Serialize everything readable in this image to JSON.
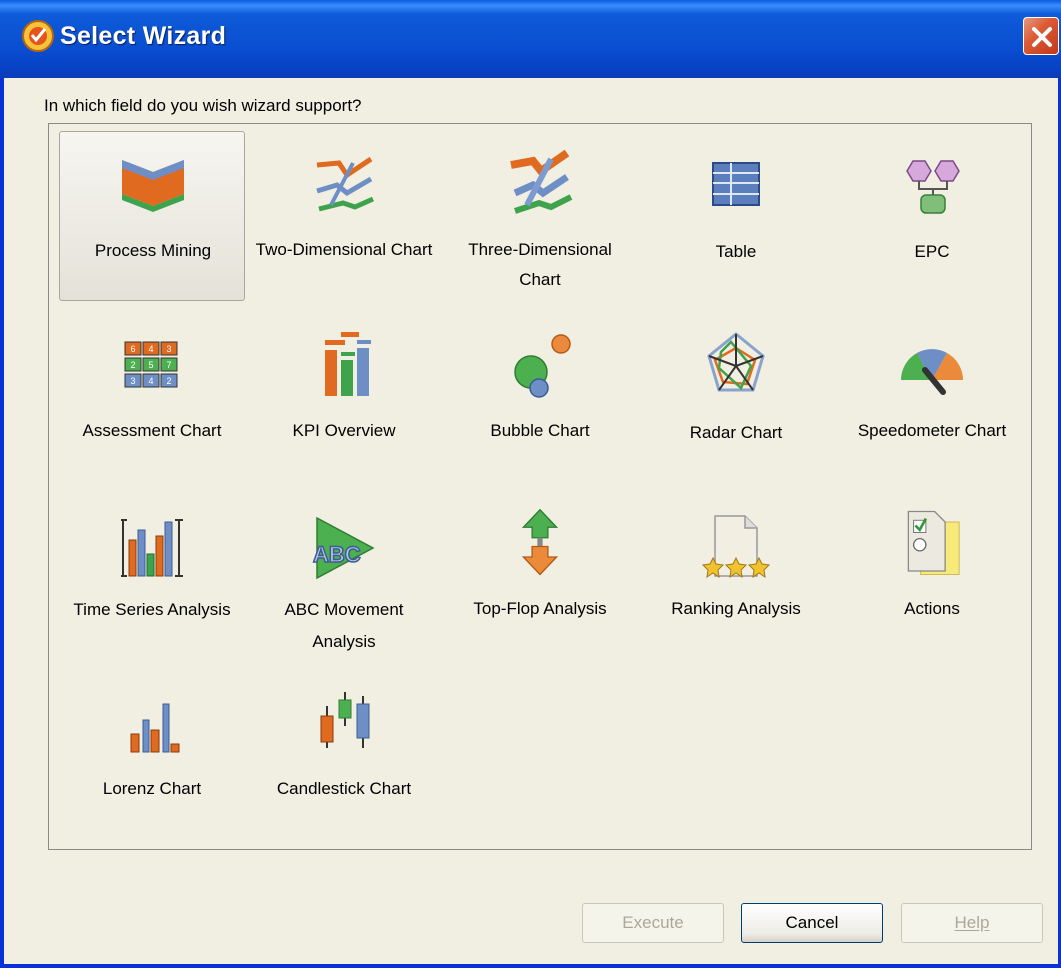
{
  "window": {
    "title": "Select Wizard"
  },
  "prompt": "In which field do you wish wizard support?",
  "wizards": [
    {
      "label": "Process Mining",
      "icon": "process-mining-icon",
      "selected": true
    },
    {
      "label": "Two-Dimensional Chart",
      "icon": "two-dimensional-chart-icon"
    },
    {
      "label": "Three-Dimensional Chart",
      "icon": "three-dimensional-chart-icon"
    },
    {
      "label": "Table",
      "icon": "table-icon"
    },
    {
      "label": "EPC",
      "icon": "epc-icon"
    },
    {
      "label": "Assessment Chart",
      "icon": "assessment-chart-icon",
      "cells": [
        "6",
        "4",
        "3",
        "2",
        "5",
        "7",
        "3",
        "4",
        "2"
      ]
    },
    {
      "label": "KPI Overview",
      "icon": "kpi-overview-icon"
    },
    {
      "label": "Bubble Chart",
      "icon": "bubble-chart-icon"
    },
    {
      "label": "Radar Chart",
      "icon": "radar-chart-icon"
    },
    {
      "label": "Speedometer Chart",
      "icon": "speedometer-chart-icon"
    },
    {
      "label": "Time Series Analysis",
      "icon": "time-series-icon"
    },
    {
      "label": "ABC Movement Analysis",
      "icon": "abc-movement-icon",
      "icon_text": "ABC"
    },
    {
      "label": "Top-Flop Analysis",
      "icon": "top-flop-icon"
    },
    {
      "label": "Ranking Analysis",
      "icon": "ranking-analysis-icon"
    },
    {
      "label": "Actions",
      "icon": "actions-icon"
    },
    {
      "label": "Lorenz Chart",
      "icon": "lorenz-chart-icon"
    },
    {
      "label": "Candlestick Chart",
      "icon": "candlestick-chart-icon"
    }
  ],
  "buttons": {
    "execute": {
      "label": "Execute",
      "enabled": false
    },
    "cancel": {
      "label": "Cancel",
      "enabled": true
    },
    "help": {
      "label": "Help",
      "enabled": false
    }
  },
  "colors": {
    "title_bar": "#0a4fd2",
    "close_button": "#dc5b35",
    "dialog_bg": "#f1efe2"
  }
}
